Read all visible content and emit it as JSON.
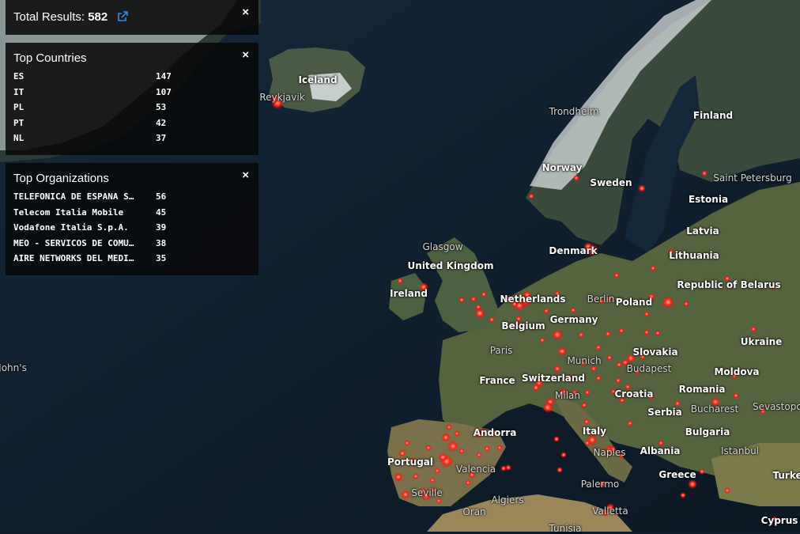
{
  "total": {
    "label": "Total Results:",
    "count": "582",
    "close": "×"
  },
  "top_countries": {
    "title": "Top Countries",
    "close": "×",
    "rows": [
      {
        "name": "ES",
        "value": "147"
      },
      {
        "name": "IT",
        "value": "107"
      },
      {
        "name": "PL",
        "value": "53"
      },
      {
        "name": "PT",
        "value": "42"
      },
      {
        "name": "NL",
        "value": "37"
      }
    ]
  },
  "top_organizations": {
    "title": "Top Organizations",
    "close": "×",
    "rows": [
      {
        "name": "TELEFONICA DE ESPANA S…",
        "value": "56"
      },
      {
        "name": "Telecom Italia Mobile",
        "value": "45"
      },
      {
        "name": "Vodafone Italia S.p.A.",
        "value": "39"
      },
      {
        "name": "MEO - SERVICOS DE COMU…",
        "value": "38"
      },
      {
        "name": "AIRE NETWORKS DEL MEDI…",
        "value": "35"
      }
    ]
  },
  "map": {
    "labels": [
      "Iceland",
      "Reykjavik",
      "Trondheim",
      "Finland",
      "Norway",
      "Sweden",
      "Saint Petersburg",
      "Estonia",
      "Glasgow",
      "United Kingdom",
      "Denmark",
      "Latvia",
      "Lithuania",
      "Ireland",
      "Netherlands",
      "Berlin",
      "Poland",
      "Republic of Belarus",
      "Belgium",
      "Germany",
      "Paris",
      "Slovakia",
      "Ukraine",
      "John's",
      "Munich",
      "Budapest",
      "Moldova",
      "France",
      "Switzerland",
      "Romania",
      "Milan",
      "Croatia",
      "Bucharest",
      "Sevastopol",
      "Serbia",
      "Andorra",
      "Italy",
      "Bulgaria",
      "Portugal",
      "Naples",
      "Albania",
      "Istanbul",
      "Valencia",
      "Greece",
      "Turkey",
      "Seville",
      "Palermo",
      "Algiers",
      "Valletta",
      "Oran",
      "Cyprus",
      "Tunisia"
    ],
    "marker_color": "#ff2a1a"
  },
  "icons": {
    "external_link": "external-link-icon",
    "close": "close-icon"
  }
}
